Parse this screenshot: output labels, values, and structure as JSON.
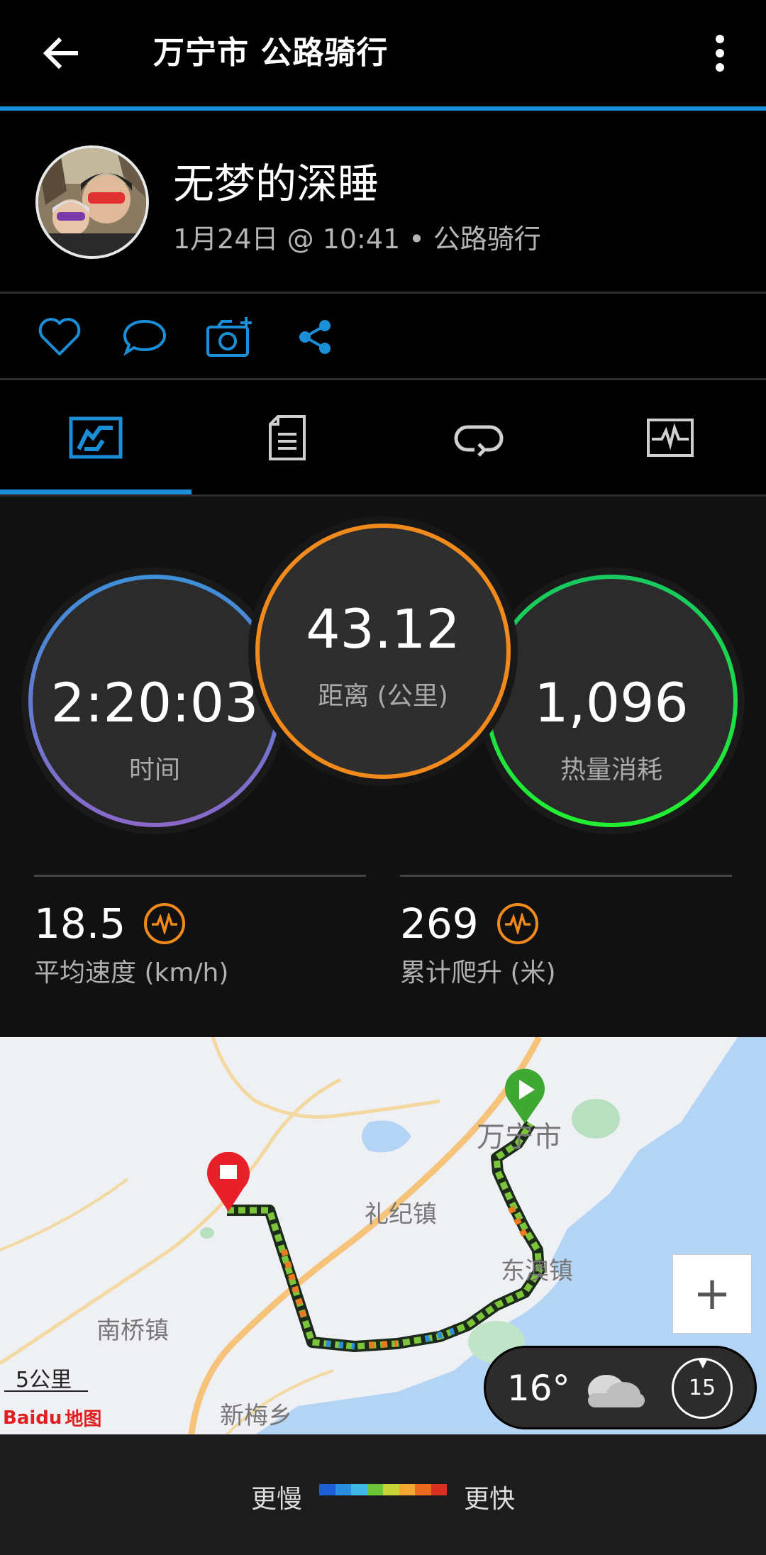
{
  "header": {
    "title": "万宁市 公路骑行"
  },
  "user": {
    "name": "无梦的深睡",
    "meta": "1月24日 @ 10:41 • 公路骑行"
  },
  "stats": {
    "time": {
      "value": "2:20:03",
      "label": "时间"
    },
    "distance": {
      "value": "43.12",
      "label": "距离 (公里)"
    },
    "calories": {
      "value": "1,096",
      "label": "热量消耗"
    },
    "avg_speed": {
      "value": "18.5",
      "label": "平均速度 (km/h)"
    },
    "elevation": {
      "value": "269",
      "label": "累计爬升 (米)"
    }
  },
  "map": {
    "places": {
      "wanning": "万宁市",
      "lijizhen": "礼纪镇",
      "dongaozhen": "东澳镇",
      "nanqiaozhen": "南桥镇",
      "xinmeixiang": "新梅乡"
    },
    "scale": "5公里",
    "provider": "Baidu",
    "provider_suffix": "地图",
    "zoom_in": "+"
  },
  "weather": {
    "temp": "16°",
    "icon": "cloud-icon",
    "wind": "15"
  },
  "legend": {
    "slower": "更慢",
    "faster": "更快",
    "colors": [
      "#1e5fd8",
      "#2a8ee0",
      "#3fb8e8",
      "#6cc63a",
      "#c6d43a",
      "#f0a830",
      "#ea6a20",
      "#d83020"
    ]
  },
  "colors": {
    "accent": "#1a8fd8",
    "time_ring": "#5b7fe0",
    "distance_ring": "#f08a1c",
    "calories_ring": "#1ed84a"
  }
}
